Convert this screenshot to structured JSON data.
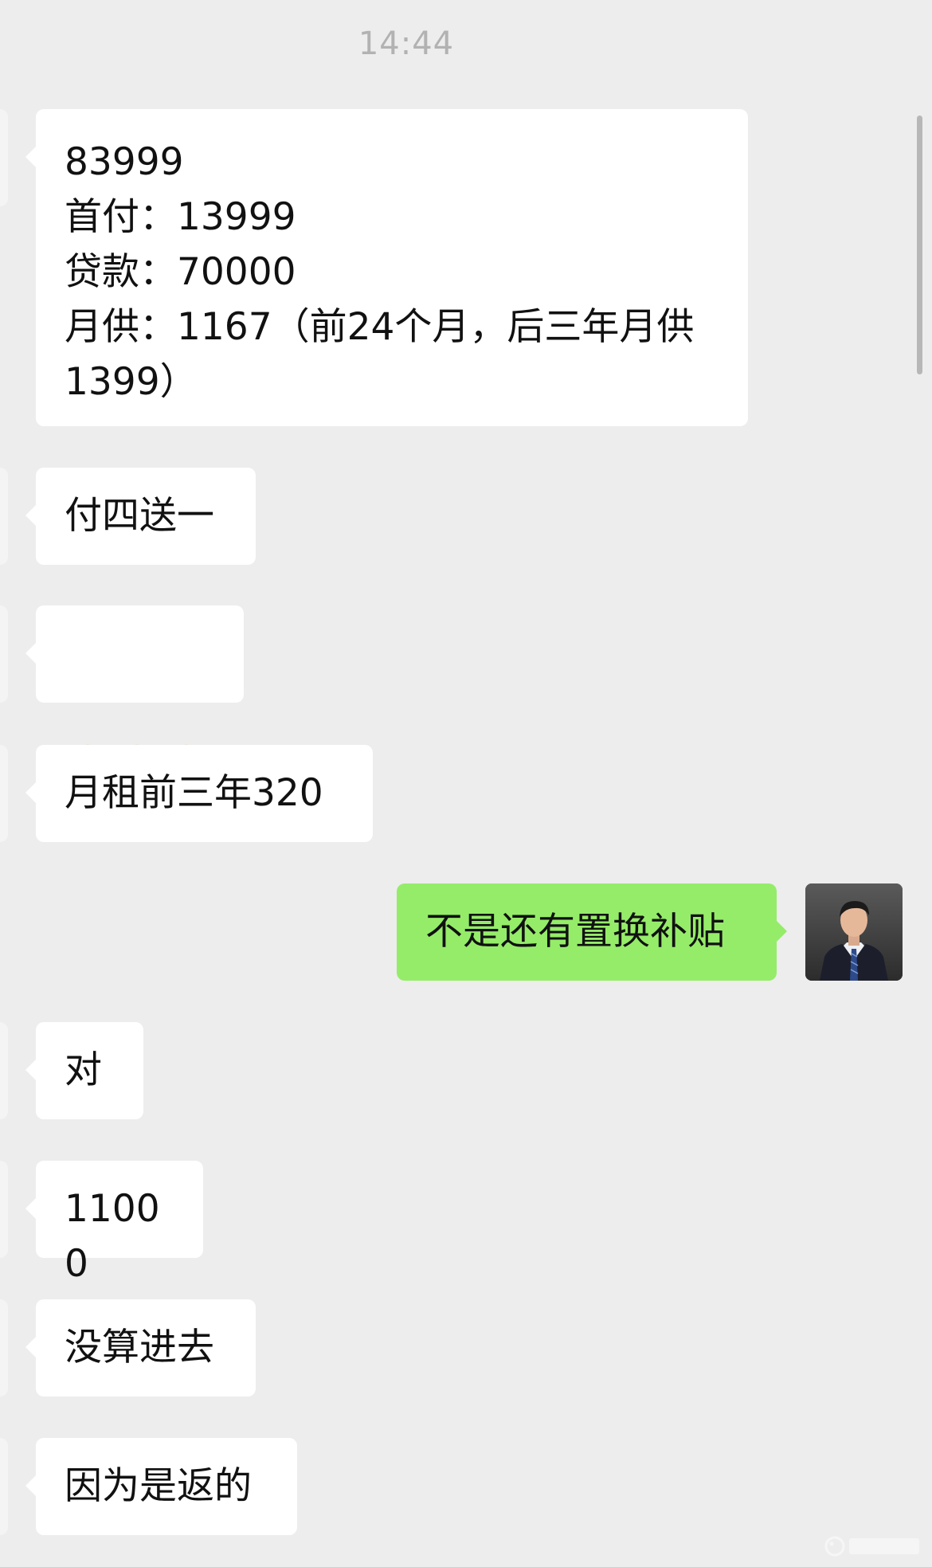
{
  "chat": {
    "timestamp": "14:44",
    "messages": [
      {
        "id": "m1",
        "side": "received",
        "text": "83999\n首付：13999\n贷款：70000\n月供：1167（前24个月，后三年月供\n1399）"
      },
      {
        "id": "m2",
        "side": "received",
        "text": "付四送一"
      },
      {
        "id": "m3",
        "side": "received",
        "type": "emoji",
        "emoji": [
          "grin-face-icon",
          "grin-face-icon",
          "grin-face-icon"
        ]
      },
      {
        "id": "m4",
        "side": "received",
        "text": "月租前三年320"
      },
      {
        "id": "m5",
        "side": "sent",
        "text": "不是还有置换补贴"
      },
      {
        "id": "m6",
        "side": "received",
        "text": "对"
      },
      {
        "id": "m7",
        "side": "received",
        "text": "11000"
      },
      {
        "id": "m8",
        "side": "received",
        "text": "没算进去"
      },
      {
        "id": "m9",
        "side": "received",
        "text": "因为是返的"
      }
    ]
  },
  "colors": {
    "background": "#ededed",
    "received_bubble": "#ffffff",
    "sent_bubble": "#95ec69",
    "timestamp": "#b2b2b2"
  }
}
